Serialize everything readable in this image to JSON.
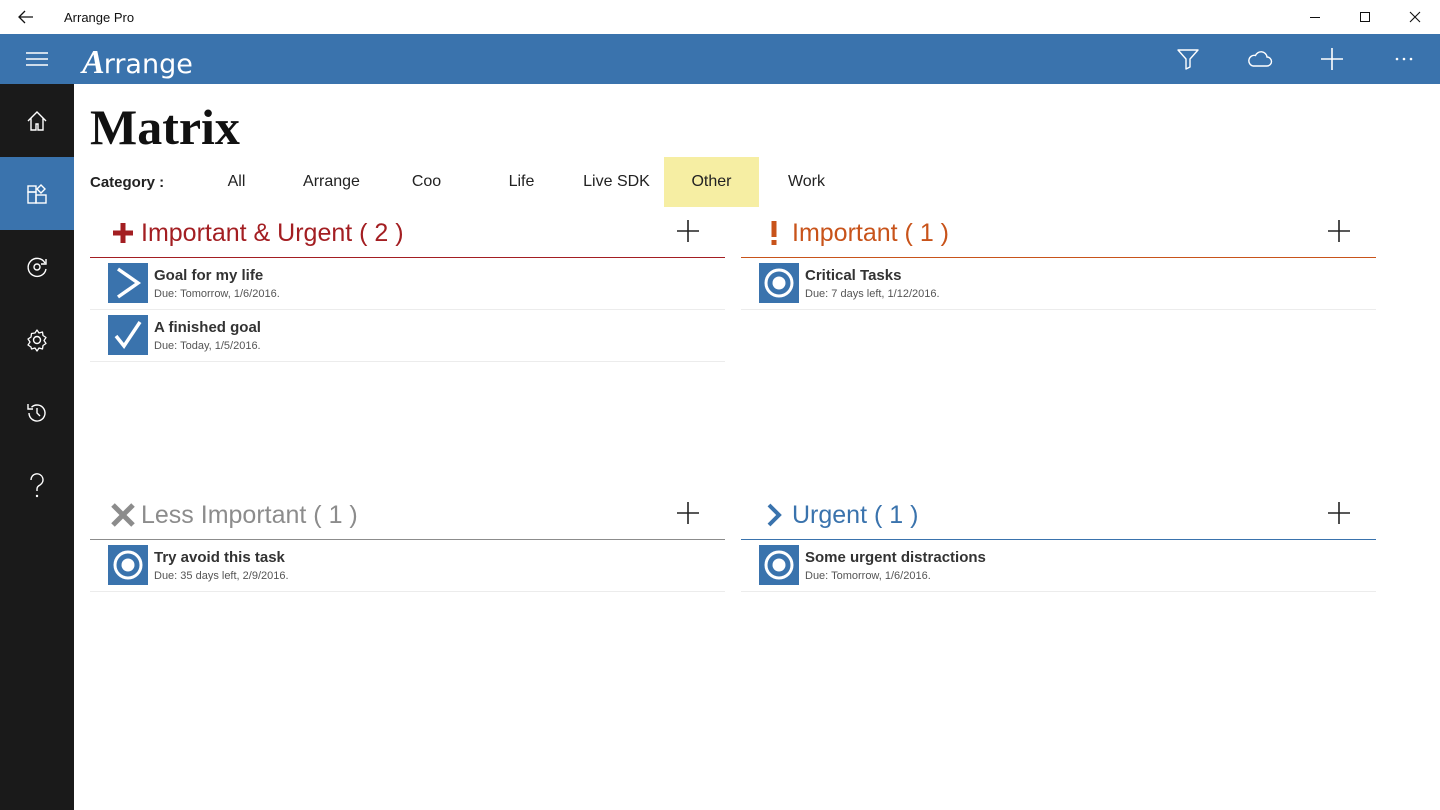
{
  "window": {
    "title": "Arrange Pro"
  },
  "appbar": {
    "logo_initial": "A",
    "logo_rest": "rrange"
  },
  "page": {
    "title": "Matrix"
  },
  "category": {
    "label": "Category :",
    "tabs": [
      "All",
      "Arrange",
      "Coo",
      "Life",
      "Live SDK",
      "Other",
      "Work"
    ],
    "selected": "Other",
    "highlight_color": "#f6eea3"
  },
  "colors": {
    "accent": "#3a73ad",
    "sidebar": "#1a1a1a"
  },
  "quadrants": [
    {
      "title": "Important & Urgent ( 2 )",
      "color": "#a31e22",
      "icon": "plus-icon",
      "tasks": [
        {
          "name": "Goal for my life",
          "due": "Due: Tomorrow, 1/6/2016.",
          "icon": "chevron-right-icon"
        },
        {
          "name": "A finished goal",
          "due": "Due: Today, 1/5/2016.",
          "icon": "checkmark-icon"
        }
      ]
    },
    {
      "title": "Important ( 1 )",
      "color": "#c8531a",
      "icon": "exclamation-icon",
      "tasks": [
        {
          "name": "Critical Tasks",
          "due": "Due: 7 days left, 1/12/2016.",
          "icon": "target-icon"
        }
      ]
    },
    {
      "title": "Less Important ( 1 )",
      "color": "#8c8c8c",
      "icon": "x-icon",
      "tasks": [
        {
          "name": "Try avoid this task",
          "due": "Due: 35 days left, 2/9/2016.",
          "icon": "target-icon"
        }
      ]
    },
    {
      "title": "Urgent ( 1 )",
      "color": "#3a73ad",
      "icon": "chevron-right-icon",
      "tasks": [
        {
          "name": "Some urgent distractions",
          "due": "Due: Tomorrow, 1/6/2016.",
          "icon": "target-icon"
        }
      ]
    }
  ]
}
